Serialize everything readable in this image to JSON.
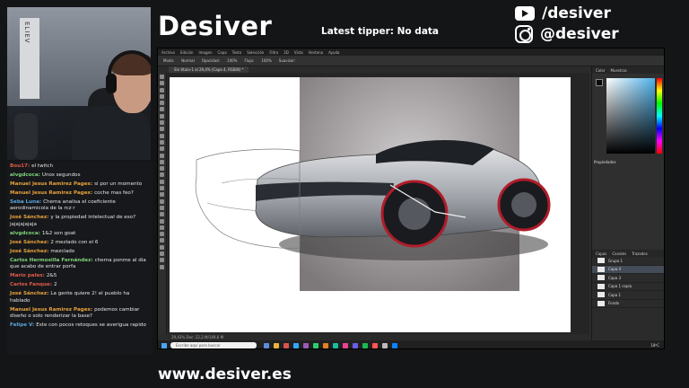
{
  "brand": "Desiver",
  "latest_tipper": "Latest tipper: No data",
  "social": {
    "youtube": "/desiver",
    "instagram": "@desiver"
  },
  "website": "www.desiver.es",
  "webcam": {
    "shelf_label": "ELIEV"
  },
  "chat": [
    {
      "user": "Bou17:",
      "color": "#e05a4b",
      "text": "el twitch"
    },
    {
      "user": "alvgdcoca:",
      "color": "#7fd37a",
      "text": "Unos segundos"
    },
    {
      "user": "Manuel Jesus Ramirez Pages:",
      "color": "#e6a23c",
      "text": "si por un momento"
    },
    {
      "user": "Manuel Jesus Ramirez Pages:",
      "color": "#e6a23c",
      "text": "coche mas feo?"
    },
    {
      "user": "Seba Luna:",
      "color": "#5aa8e0",
      "text": "Chema analisa el coeficiente aerodinamicola de la rcz r"
    },
    {
      "user": "José Sánchez:",
      "color": "#e6a23c",
      "text": "y la propiedad intelectual de eso? jajajajajaja"
    },
    {
      "user": "alvgdcoca:",
      "color": "#7fd37a",
      "text": "1&2 son goat"
    },
    {
      "user": "José Sánchez:",
      "color": "#e6a23c",
      "text": "2 mezlado con el 6"
    },
    {
      "user": "José Sánchez:",
      "color": "#e6a23c",
      "text": "mezclado"
    },
    {
      "user": "Carlos Hermosilla Fernández:",
      "color": "#7fd37a",
      "text": "chema ponme al dia que acabo de entrar porfa"
    },
    {
      "user": "Mario pales:",
      "color": "#e05a4b",
      "text": "2&5"
    },
    {
      "user": "Carlos Fanque:",
      "color": "#e05a4b",
      "text": "2"
    },
    {
      "user": "José Sánchez:",
      "color": "#e6a23c",
      "text": "La gente quiere 2! el pueblo ha hablado"
    },
    {
      "user": "Manuel Jesus Ramirez Pages:",
      "color": "#e6a23c",
      "text": "podemos cambiar diseño o solo renderizar la base?"
    },
    {
      "user": "Felipe V:",
      "color": "#5aa8e0",
      "text": "Este con pocos retoques se averigua rapido"
    }
  ],
  "ps": {
    "menus": [
      "Archivo",
      "Edición",
      "Imagen",
      "Capa",
      "Texto",
      "Selección",
      "Filtro",
      "3D",
      "Vista",
      "Ventana",
      "Ayuda"
    ],
    "options": [
      "Modo:",
      "Normal",
      "Opacidad:",
      "100%",
      "Flujo:",
      "100%",
      "Suavizar:"
    ],
    "doc_tab": "Sin título-1 al 29,4% (Capa 4, RGB/8) *",
    "status": "29,43%     Doc: 22,2 M/149,6 M",
    "panel_tabs": [
      "Color",
      "Muestras"
    ],
    "properties_title": "Propiedades",
    "layers_tabs": [
      "Capas",
      "Canales",
      "Trazados"
    ],
    "layers": [
      {
        "name": "Grupo 1",
        "active": false
      },
      {
        "name": "Capa 4",
        "active": true
      },
      {
        "name": "Capa 3",
        "active": false
      },
      {
        "name": "Capa 1 copia",
        "active": false
      },
      {
        "name": "Capa 1",
        "active": false
      },
      {
        "name": "Fondo",
        "active": false
      }
    ],
    "taskbar_search": "Escribe aquí para buscar",
    "tray": "18ºC"
  }
}
